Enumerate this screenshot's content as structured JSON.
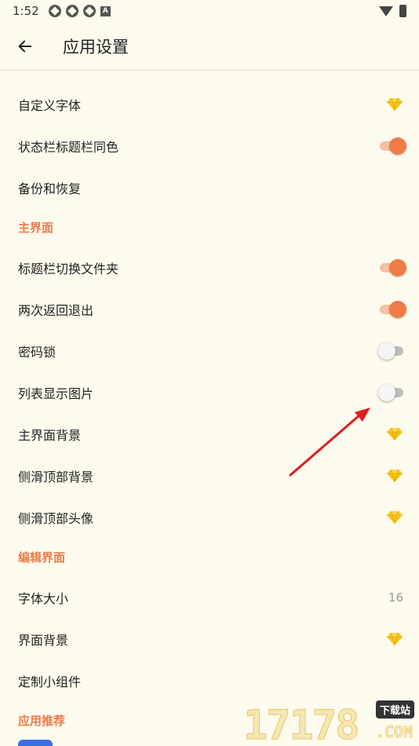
{
  "status_bar": {
    "time": "1:52",
    "notification_letter": "A"
  },
  "app_bar": {
    "title": "应用设置"
  },
  "settings": {
    "items": [
      {
        "type": "row",
        "label": "自定义字体",
        "trailing": "gem"
      },
      {
        "type": "row",
        "label": "状态栏标题栏同色",
        "trailing": "toggle",
        "on": true
      },
      {
        "type": "row",
        "label": "备份和恢复",
        "trailing": "none"
      },
      {
        "type": "section",
        "label": "主界面"
      },
      {
        "type": "row",
        "label": "标题栏切换文件夹",
        "trailing": "toggle",
        "on": true
      },
      {
        "type": "row",
        "label": "两次返回退出",
        "trailing": "toggle",
        "on": true
      },
      {
        "type": "row",
        "label": "密码锁",
        "trailing": "toggle",
        "on": false
      },
      {
        "type": "row",
        "label": "列表显示图片",
        "trailing": "toggle",
        "on": false
      },
      {
        "type": "row",
        "label": "主界面背景",
        "trailing": "gem"
      },
      {
        "type": "row",
        "label": "侧滑顶部背景",
        "trailing": "gem"
      },
      {
        "type": "row",
        "label": "侧滑顶部头像",
        "trailing": "gem"
      },
      {
        "type": "section",
        "label": "编辑界面"
      },
      {
        "type": "row",
        "label": "字体大小",
        "trailing": "value",
        "value": "16"
      },
      {
        "type": "row",
        "label": "界面背景",
        "trailing": "gem"
      },
      {
        "type": "row",
        "label": "定制小组件",
        "trailing": "none"
      },
      {
        "type": "section",
        "label": "应用推荐"
      }
    ]
  },
  "watermark": {
    "digits": "17178",
    "badge": "下载站",
    "suffix": ".COM"
  },
  "colors": {
    "accent": "#f07b47",
    "gem": "#f5c518",
    "background": "#fdfbee"
  }
}
